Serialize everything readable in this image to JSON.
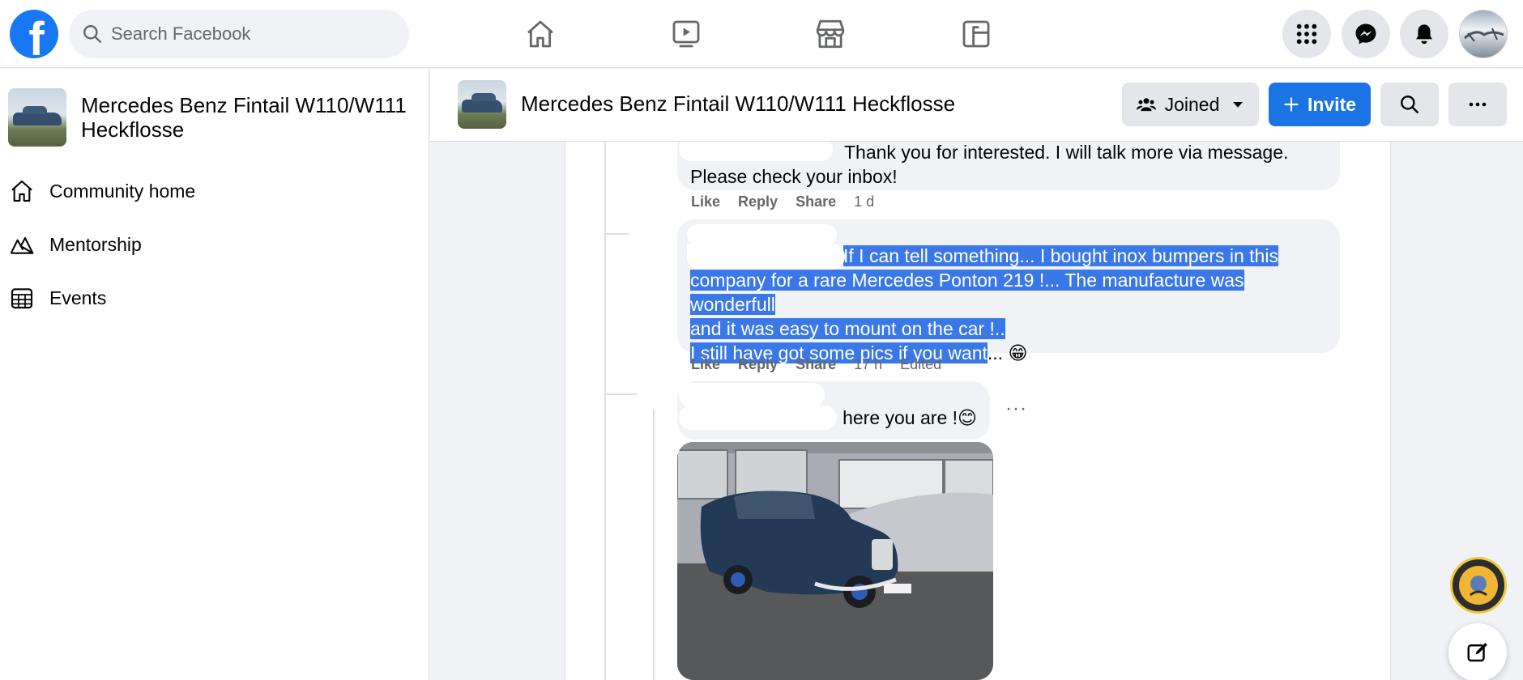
{
  "topbar": {
    "logo": "f",
    "search_placeholder": "Search Facebook",
    "nav_icons": [
      "home-icon",
      "watch-icon",
      "marketplace-icon",
      "gaming-icon"
    ],
    "right_icons": [
      "menu-grid-icon",
      "messenger-icon",
      "notifications-icon",
      "account-avatar"
    ]
  },
  "sidebar": {
    "group_name": "Mercedes Benz Fintail W110/W111 Heckflosse",
    "items": [
      {
        "label": "Community home",
        "icon": "home-icon"
      },
      {
        "label": "Mentorship",
        "icon": "mentorship-icon"
      },
      {
        "label": "Events",
        "icon": "calendar-icon"
      }
    ]
  },
  "group_header": {
    "title": "Mercedes Benz Fintail W110/W111 Heckflosse",
    "joined_label": "Joined",
    "invite_label": "Invite"
  },
  "comments": [
    {
      "text_line1": "Thank you for interested. I will talk more via message.",
      "text_line2": "Please check your inbox!",
      "like": "Like",
      "reply": "Reply",
      "share": "Share",
      "time": "1 d"
    },
    {
      "line1": "If I can tell something... I bought inox bumpers in this",
      "line2": "company for a rare Mercedes Ponton 219 !... The manufacture was wonderfull",
      "line3": "and it was easy to mount on the car !..",
      "line4_selected": "I still have got some pics if you want",
      "line4_rest": "... 😁",
      "like": "Like",
      "reply": "Reply",
      "share": "Share",
      "time": "17 h",
      "edited": "Edited"
    },
    {
      "text": "here you are !😊",
      "more": "···"
    }
  ]
}
